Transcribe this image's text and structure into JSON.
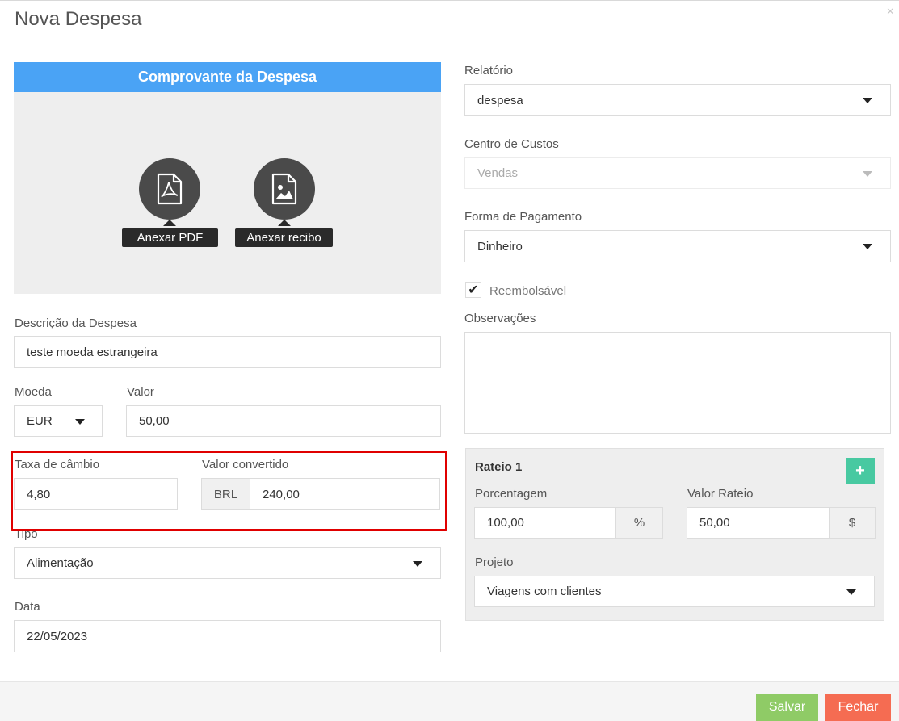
{
  "modal": {
    "title": "Nova Despesa",
    "close": "×"
  },
  "receipt": {
    "header": "Comprovante da Despesa",
    "pdf_label": "Anexar PDF",
    "image_label": "Anexar recibo"
  },
  "descricao": {
    "label": "Descrição da Despesa",
    "value": "teste moeda estrangeira"
  },
  "moeda": {
    "label": "Moeda",
    "value": "EUR"
  },
  "valor": {
    "label": "Valor",
    "value": "50,00"
  },
  "taxa": {
    "label": "Taxa de câmbio",
    "value": "4,80"
  },
  "convertido": {
    "label": "Valor convertido",
    "currency": "BRL",
    "value": "240,00"
  },
  "tipo": {
    "label": "Tipo",
    "value": "Alimentação"
  },
  "data": {
    "label": "Data",
    "value": "22/05/2023"
  },
  "relatorio": {
    "label": "Relatório",
    "value": "despesa"
  },
  "centro": {
    "label": "Centro de Custos",
    "value": "Vendas"
  },
  "pagamento": {
    "label": "Forma de Pagamento",
    "value": "Dinheiro"
  },
  "reembolsavel": {
    "label": "Reembolsável",
    "checked": true,
    "check": "✔"
  },
  "observacoes": {
    "label": "Observações",
    "value": ""
  },
  "rateio": {
    "title": "Rateio 1",
    "add": "+",
    "porcentagem_label": "Porcentagem",
    "porcentagem_value": "100,00",
    "porcentagem_suffix": "%",
    "valor_label": "Valor Rateio",
    "valor_value": "50,00",
    "valor_suffix": "$",
    "projeto_label": "Projeto",
    "projeto_value": "Viagens com clientes"
  },
  "footer": {
    "save": "Salvar",
    "close": "Fechar"
  },
  "colors": {
    "accent": "#4aa3f5",
    "save": "#8fcb66",
    "close": "#f56c52",
    "add": "#48c9a1",
    "highlight": "#e00000"
  }
}
